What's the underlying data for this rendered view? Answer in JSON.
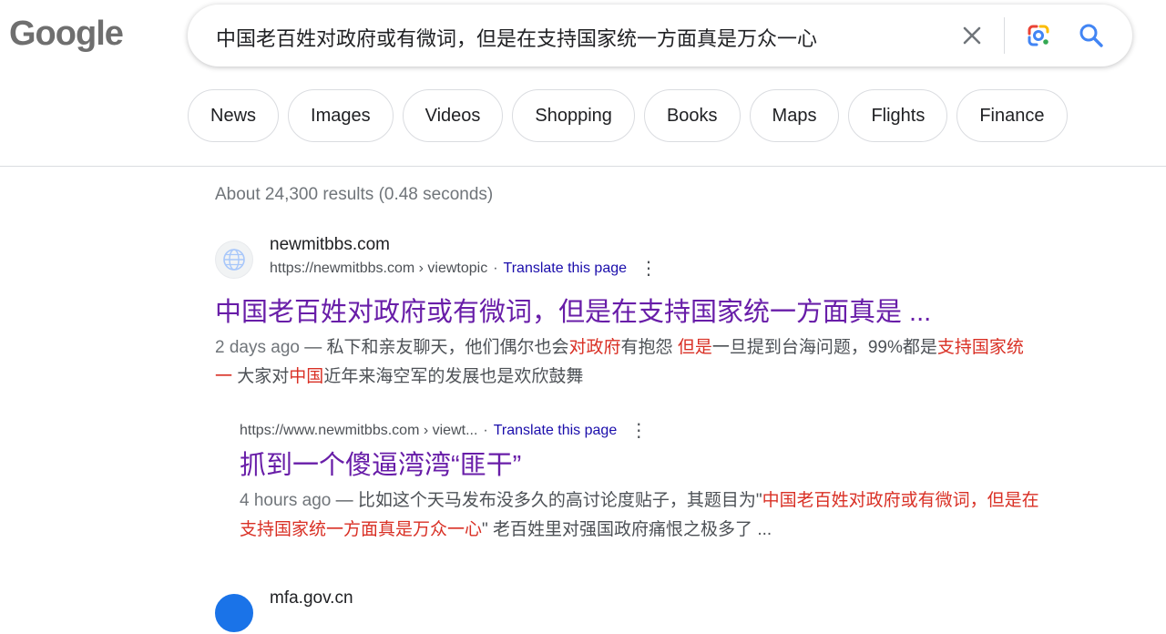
{
  "logo": "Google",
  "search": {
    "query": "中国老百姓对政府或有微词，但是在支持国家统一方面真是万众一心"
  },
  "icons": {
    "clear": "close-icon",
    "lens": "google-lens-icon",
    "search": "magnifier-icon",
    "favicon": "globe-icon",
    "more": "vertical-dots-icon"
  },
  "colors": {
    "link_visited": "#681da8",
    "translate_link": "#1a0dab",
    "highlight": "#d93025",
    "search_icon": "#4285f4"
  },
  "chips": [
    "News",
    "Images",
    "Videos",
    "Shopping",
    "Books",
    "Maps",
    "Flights",
    "Finance"
  ],
  "stats": "About 24,300 results (0.48 seconds)",
  "results": [
    {
      "site_name": "newmitbbs.com",
      "url": "https://newmitbbs.com › viewtopic",
      "translate": "Translate this page",
      "title": "中国老百姓对政府或有微词，但是在支持国家统一方面真是 ...",
      "snippet_date": "2 days ago",
      "snippet_parts": [
        " — 私下和亲友聊天，他们偶尔也会",
        "对政府",
        "有抱怨 ",
        "但是",
        "一旦提到台海问题，99%都是",
        "支持国家统一",
        " 大家对",
        "中国",
        "近年来海空军的发展也是欢欣鼓舞"
      ],
      "sub": {
        "url": "https://www.newmitbbs.com › viewt...",
        "translate": "Translate this page",
        "title": "抓到一个傻逼湾湾“匪干”",
        "snippet_date": "4 hours ago",
        "snippet_parts": [
          " — 比如这个天马发布没多久的高讨论度贴子，其题目为\"",
          "中国老百姓对政府或有微词，但是在支持国家统一方面真是万众一心",
          "\" 老百姓里对强国政府痛恨之极多了 ..."
        ]
      }
    },
    {
      "site_name": "mfa.gov.cn"
    }
  ]
}
